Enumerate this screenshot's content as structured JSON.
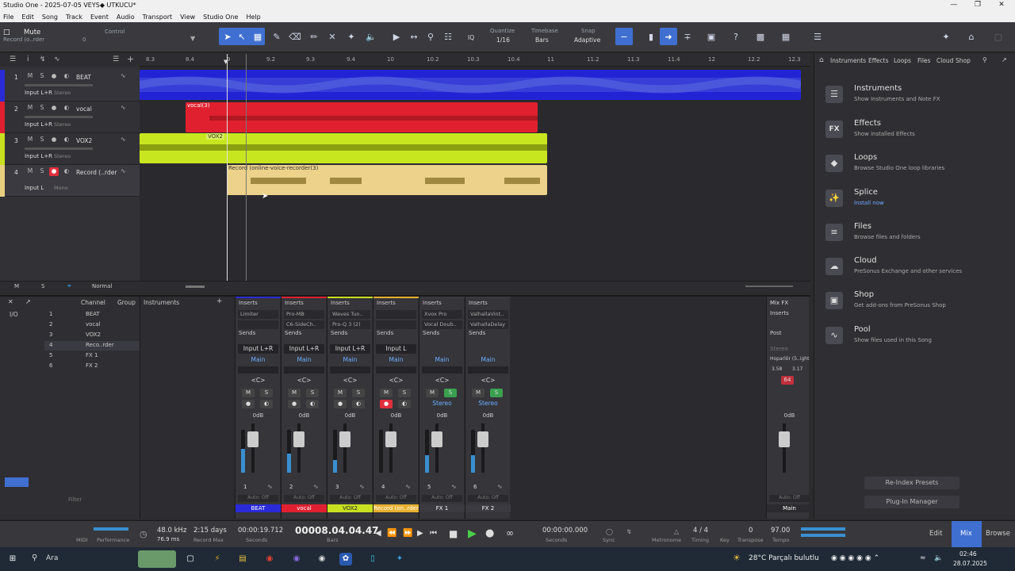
{
  "window": {
    "title": "Studio One - 2025-07-05 VEYS◆ UTKUCU*",
    "minimize": "—",
    "maximize": "❐",
    "close": "✕"
  },
  "menu": [
    "File",
    "Edit",
    "Song",
    "Track",
    "Event",
    "Audio",
    "Transport",
    "View",
    "Studio One",
    "Help"
  ],
  "toolbar": {
    "mute_label": "Mute",
    "mute_sub": "Record (o..rder",
    "mute_val": "0",
    "control_label": "Control",
    "quantize_label": "Quantize",
    "quantize_value": "1/16",
    "timebase_label": "Timebase",
    "timebase_value": "Bars",
    "snap_label": "Snap",
    "snap_value": "Adaptive",
    "iq": "IQ"
  },
  "ruler_ticks": [
    "8.3",
    "8.4",
    "9",
    "9.2",
    "9.3",
    "9.4",
    "10",
    "10.2",
    "10.3",
    "10.4",
    "11",
    "11.2",
    "11.3",
    "11.4",
    "12",
    "12.2",
    "12.3"
  ],
  "tracks": [
    {
      "num": "1",
      "name": "BEAT",
      "input": "Input L+R",
      "mode": "Stereo",
      "color": "#2a2ad8"
    },
    {
      "num": "2",
      "name": "vocal",
      "input": "Input L+R",
      "mode": "Stereo",
      "color": "#e02030"
    },
    {
      "num": "3",
      "name": "VOX2",
      "input": "Input L+R",
      "mode": "Stereo",
      "color": "#c8e020"
    },
    {
      "num": "4",
      "name": "Record (..rder",
      "input": "Input L",
      "mode": "Mono",
      "color": "#e8cf80"
    }
  ],
  "track_buttons": {
    "m": "M",
    "s": "S"
  },
  "clips": [
    {
      "label": "",
      "color": "#2323d6"
    },
    {
      "label": "vocal(3)",
      "color": "#e0202e"
    },
    {
      "label": "VOX2",
      "color": "#c8e620"
    },
    {
      "label": "Record (online-voice-recorder(3)",
      "color": "#ecd28a"
    }
  ],
  "editor_footer": {
    "m": "M",
    "s": "S",
    "mode": "Normal"
  },
  "browser": {
    "tabs": [
      "Instruments",
      "Effects",
      "Loops",
      "Files",
      "Cloud",
      "Shop"
    ],
    "items": [
      {
        "title": "Instruments",
        "sub": "Show Instruments and Note FX",
        "icon": "piano-icon",
        "glyph": "☰"
      },
      {
        "title": "Effects",
        "sub": "Show installed Effects",
        "icon": "fx-icon",
        "glyph": "FX"
      },
      {
        "title": "Loops",
        "sub": "Browse Studio One loop libraries",
        "icon": "loops-icon",
        "glyph": "◆"
      },
      {
        "title": "Splice",
        "sub": "Install now",
        "icon": "splice-icon",
        "glyph": "✨"
      },
      {
        "title": "Files",
        "sub": "Browse files and folders",
        "icon": "files-icon",
        "glyph": "≡"
      },
      {
        "title": "Cloud",
        "sub": "PreSonus Exchange and other services",
        "icon": "cloud-icon",
        "glyph": "☁"
      },
      {
        "title": "Shop",
        "sub": "Get add-ons from PreSonus Shop",
        "icon": "shop-icon",
        "glyph": "▣"
      },
      {
        "title": "Pool",
        "sub": "Show files used in this Song",
        "icon": "pool-icon",
        "glyph": "∿"
      }
    ],
    "reindex": "Re-Index Presets",
    "plugin_manager": "Plug-In Manager"
  },
  "mixer": {
    "channel_header": "Channel",
    "group_header": "Group",
    "instruments_header": "Instruments",
    "io": "I/O",
    "channel_list": [
      {
        "num": "1",
        "name": "BEAT"
      },
      {
        "num": "2",
        "name": "vocal"
      },
      {
        "num": "3",
        "name": "VOX2"
      },
      {
        "num": "4",
        "name": "Reco..rder"
      },
      {
        "num": "5",
        "name": "FX 1"
      },
      {
        "num": "6",
        "name": "FX 2"
      }
    ],
    "filter": "Filter",
    "strips": [
      {
        "inserts": "Inserts",
        "slot1": "Limiter",
        "slot2": "",
        "sends": "Sends",
        "io": "Input L+R",
        "out": "Main",
        "pan": "<C>",
        "db": "0dB",
        "num": "1",
        "auto": "Auto: Off",
        "name": "BEAT",
        "color": "#2a2ad8",
        "level": 0.55
      },
      {
        "inserts": "Inserts",
        "slot1": "Pro-MB",
        "slot2": "C6-SideCh..",
        "sends": "Sends",
        "io": "Input L+R",
        "out": "Main",
        "pan": "<C>",
        "db": "0dB",
        "num": "2",
        "auto": "Auto: Off",
        "name": "vocal",
        "color": "#e02030",
        "level": 0.45
      },
      {
        "inserts": "Inserts",
        "slot1": "Waves Tun..",
        "slot2": "Pro-Q 3 (2)",
        "sends": "Sends",
        "io": "Input L+R",
        "out": "Main",
        "pan": "<C>",
        "db": "0dB",
        "num": "3",
        "auto": "Auto: Off",
        "name": "VOX2",
        "color": "#c8e020",
        "level": 0.3
      },
      {
        "inserts": "Inserts",
        "slot1": "",
        "slot2": "",
        "sends": "Sends",
        "io": "Input L",
        "out": "Main",
        "pan": "<C>",
        "db": "0dB",
        "num": "4",
        "auto": "Auto: Off",
        "name": "Record (on..rder",
        "color": "#e8b030",
        "level": 0.0
      },
      {
        "inserts": "Inserts",
        "slot1": "Xvox Pro",
        "slot2": "Vocal Doub..",
        "sends": "Sends",
        "io": "",
        "out": "Main",
        "pan": "<C>",
        "db": "0dB",
        "num": "5",
        "auto": "Auto: Off",
        "name": "FX 1",
        "color": "#3a3a40",
        "level": 0.4,
        "stereo": "Stereo"
      },
      {
        "inserts": "Inserts",
        "slot1": "ValhallaVint..",
        "slot2": "ValhallaDelay",
        "sends": "Sends",
        "io": "",
        "out": "Main",
        "pan": "<C>",
        "db": "0dB",
        "num": "6",
        "auto": "Auto: Off",
        "name": "FX 2",
        "color": "#3a3a40",
        "level": 0.4,
        "stereo": "Stereo"
      }
    ],
    "main": {
      "mixfx": "Mix FX",
      "inserts": "Inserts",
      "post": "Post",
      "stereo": "Stereo",
      "out": "Hoparlör (5..ight",
      "l": "3.58",
      "r": "3.17",
      "peak": "64",
      "db": "0dB",
      "auto": "Auto: Off",
      "name": "Main"
    }
  },
  "transport": {
    "midi": "MIDI",
    "performance": "Performance",
    "samplerate": "48.0 kHz",
    "latency": "76.9 ms",
    "record_max_val": "2:15 days",
    "record_max": "Record Max",
    "seconds_val": "00:00:19.712",
    "seconds": "Seconds",
    "bars_val": "00008.04.04.47",
    "bars": "Bars",
    "l_val": "00:00:00.000",
    "l_lbl": "Seconds",
    "sync": "Sync",
    "metronome": "Metronome",
    "timing_val": "4 / 4",
    "timing": "Timing",
    "key": "Key",
    "transpose_val": "0",
    "transpose": "Transpose",
    "tempo_val": "97.00",
    "tempo": "Tempo",
    "edit": "Edit",
    "mix": "Mix",
    "browse": "Browse"
  },
  "taskbar": {
    "search": "Ara",
    "weather": "28°C  Parçalı bulutlu",
    "time": "02:46",
    "date": "28.07.2025"
  }
}
